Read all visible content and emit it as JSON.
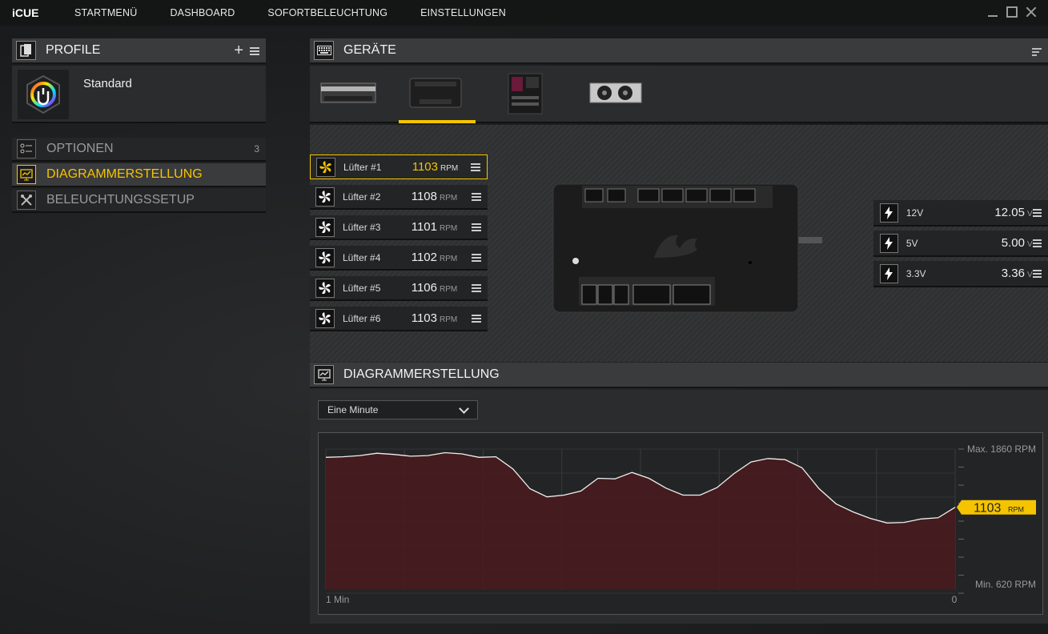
{
  "app": {
    "name": "iCUE"
  },
  "nav": [
    "STARTMENÜ",
    "DASHBOARD",
    "SOFORTBELEUCHTUNG",
    "EINSTELLUNGEN"
  ],
  "profile": {
    "title": "PROFILE",
    "name": "Standard",
    "add": "+"
  },
  "sidebar": [
    {
      "label": "OPTIONEN",
      "badge": "3"
    },
    {
      "label": "DIAGRAMMERSTELLUNG"
    },
    {
      "label": "BELEUCHTUNGSSETUP"
    }
  ],
  "devices": {
    "title": "GERÄTE",
    "tabs": [
      "memory",
      "fan-controller",
      "motherboard",
      "graphics-card"
    ]
  },
  "fans": [
    {
      "name": "Lüfter #1",
      "value": "1103",
      "unit": "RPM"
    },
    {
      "name": "Lüfter #2",
      "value": "1108",
      "unit": "RPM"
    },
    {
      "name": "Lüfter #3",
      "value": "1101",
      "unit": "RPM"
    },
    {
      "name": "Lüfter #4",
      "value": "1102",
      "unit": "RPM"
    },
    {
      "name": "Lüfter #5",
      "value": "1106",
      "unit": "RPM"
    },
    {
      "name": "Lüfter #6",
      "value": "1103",
      "unit": "RPM"
    }
  ],
  "voltages": [
    {
      "name": "12V",
      "value": "12.05",
      "unit": "V"
    },
    {
      "name": "5V",
      "value": "5.00",
      "unit": "V"
    },
    {
      "name": "3.3V",
      "value": "3.36",
      "unit": "V"
    }
  ],
  "diagram": {
    "title": "DIAGRAMMERSTELLUNG",
    "range": "Eine Minute"
  },
  "colors": {
    "accent": "#f5c400",
    "fill": "#4a1a1d"
  },
  "chart_data": {
    "type": "area",
    "ymin": 620,
    "ymax": 1860,
    "ylabel_max": "Max. 1860 RPM",
    "ylabel_min": "Min. 620 RPM",
    "xlabel_left": "1 Min",
    "xlabel_right": "0",
    "current": {
      "value": "1103",
      "unit": "RPM"
    },
    "values": [
      1720,
      1725,
      1735,
      1755,
      1745,
      1730,
      1735,
      1760,
      1750,
      1720,
      1725,
      1620,
      1450,
      1380,
      1395,
      1430,
      1540,
      1535,
      1590,
      1540,
      1455,
      1395,
      1395,
      1460,
      1580,
      1680,
      1710,
      1700,
      1630,
      1450,
      1320,
      1250,
      1195,
      1155,
      1160,
      1190,
      1200,
      1290
    ]
  }
}
